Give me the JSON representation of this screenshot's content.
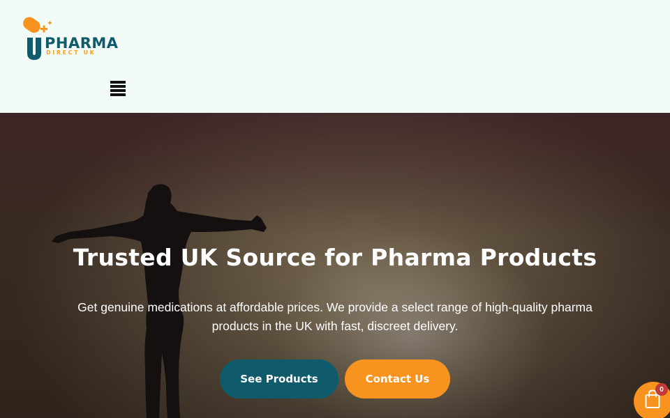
{
  "header": {
    "logo": {
      "main_text": "PHARMA",
      "sub_text": "DIRECT UK",
      "mark_letter": "U"
    },
    "menu_icon": "hamburger-icon"
  },
  "hero": {
    "title": "Trusted UK Source for Pharma Products",
    "subtitle": "Get genuine medications at affordable prices. We provide a select range of high-quality pharma products in the UK with fast, discreet delivery.",
    "buttons": {
      "products_label": "See Products",
      "contact_label": "Contact Us"
    }
  },
  "cart": {
    "count": "0",
    "icon": "shopping-bag-icon"
  },
  "colors": {
    "brand_teal": "#0f5a6b",
    "brand_orange": "#f7931e",
    "header_bg": "#f3fbf6",
    "badge_red": "#c43a3a"
  }
}
